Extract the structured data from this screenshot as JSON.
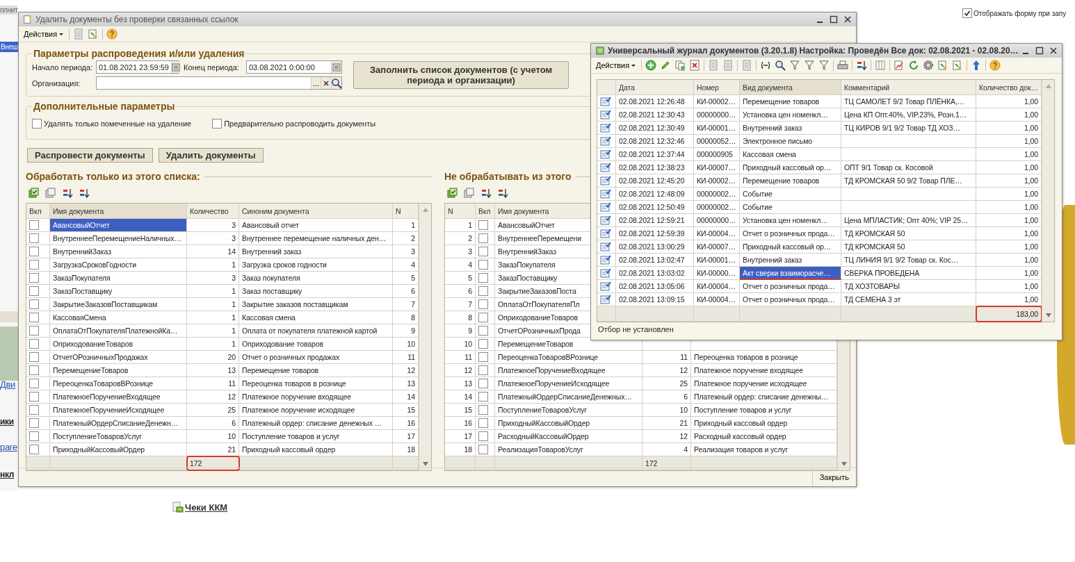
{
  "background": {
    "fragments": [
      {
        "text": "плнит",
        "kind": "title"
      },
      {
        "text": "Внеш",
        "kind": "tab"
      },
      {
        "text": "Дви",
        "kind": "link"
      },
      {
        "text": "ики",
        "kind": "bold"
      },
      {
        "text": "раге",
        "kind": "link"
      },
      {
        "text": "нкл",
        "kind": "bold"
      }
    ],
    "show_form_option": {
      "label": "Отображать форму при запу",
      "checked": true
    },
    "receipts_link": "Чеки ККМ"
  },
  "main_window": {
    "title": "Удалить документы без проверки связанных ссылок",
    "actions_menu": "Действия",
    "params_group": {
      "title": "Параметры распроведения и/или удаления",
      "start_label": "Начало периода:",
      "start_value": "01.08.2021 23:59:59",
      "end_label": "Конец периода:",
      "end_value": "03.08.2021  0:00:00",
      "org_label": "Организация:",
      "org_select_button": "...",
      "fill_button": "Заполнить список документов (с учетом периода и организации)"
    },
    "extra_group": {
      "title": "Дополнительные параметры",
      "options": [
        {
          "label": "Удалять только помеченные на удаление",
          "checked": false
        },
        {
          "label": "Предварительно распроводить документы",
          "checked": false
        }
      ]
    },
    "buttons": [
      "Распровести документы",
      "Удалить документы"
    ],
    "process_list": {
      "title": "Обработать только из этого списка:",
      "columns": [
        "Вкл",
        "Имя документа",
        "Количество",
        "Синоним документа",
        "N"
      ],
      "rows": [
        {
          "checked": false,
          "name": "АвансовыйОтчет",
          "qty": "3",
          "synonym": "Авансовый отчет",
          "n": "1",
          "selected": true
        },
        {
          "checked": false,
          "name": "ВнутреннееПеремещениеНаличных…",
          "qty": "3",
          "synonym": "Внутреннее перемещение наличных ден…",
          "n": "2",
          "selected": false
        },
        {
          "checked": false,
          "name": "ВнутреннийЗаказ",
          "qty": "14",
          "synonym": "Внутренний заказ",
          "n": "3",
          "selected": false
        },
        {
          "checked": false,
          "name": "ЗагрузкаСроковГодности",
          "qty": "1",
          "synonym": "Загрузка сроков годности",
          "n": "4",
          "selected": false
        },
        {
          "checked": false,
          "name": "ЗаказПокупателя",
          "qty": "3",
          "synonym": "Заказ покупателя",
          "n": "5",
          "selected": false
        },
        {
          "checked": false,
          "name": "ЗаказПоставщику",
          "qty": "1",
          "synonym": "Заказ поставщику",
          "n": "6",
          "selected": false
        },
        {
          "checked": false,
          "name": "ЗакрытиеЗаказовПоставщикам",
          "qty": "1",
          "synonym": "Закрытие заказов поставщикам",
          "n": "7",
          "selected": false
        },
        {
          "checked": false,
          "name": "КассоваяСмена",
          "qty": "1",
          "synonym": "Кассовая смена",
          "n": "8",
          "selected": false
        },
        {
          "checked": false,
          "name": "ОплатаОтПокупателяПлатежнойКа…",
          "qty": "1",
          "synonym": "Оплата от покупателя платежной картой",
          "n": "9",
          "selected": false
        },
        {
          "checked": false,
          "name": "ОприходованиеТоваров",
          "qty": "1",
          "synonym": "Оприходование товаров",
          "n": "10",
          "selected": false
        },
        {
          "checked": false,
          "name": "ОтчетОРозничныхПродажах",
          "qty": "20",
          "synonym": "Отчет о розничных продажах",
          "n": "11",
          "selected": false
        },
        {
          "checked": false,
          "name": "ПеремещениеТоваров",
          "qty": "13",
          "synonym": "Перемещение товаров",
          "n": "12",
          "selected": false
        },
        {
          "checked": false,
          "name": "ПереоценкаТоваровВРознице",
          "qty": "11",
          "synonym": "Переоценка товаров в рознице",
          "n": "13",
          "selected": false
        },
        {
          "checked": false,
          "name": "ПлатежноеПоручениеВходящее",
          "qty": "12",
          "synonym": "Платежное поручение входящее",
          "n": "14",
          "selected": false
        },
        {
          "checked": false,
          "name": "ПлатежноеПоручениеИсходящее",
          "qty": "25",
          "synonym": "Платежное поручение исходящее",
          "n": "15",
          "selected": false
        },
        {
          "checked": false,
          "name": "ПлатежныйОрдерСписаниеДенежн…",
          "qty": "6",
          "synonym": "Платежный ордер: списание денежных …",
          "n": "16",
          "selected": false
        },
        {
          "checked": false,
          "name": "ПоступлениеТоваровУслуг",
          "qty": "10",
          "synonym": "Поступление товаров и услуг",
          "n": "17",
          "selected": false
        },
        {
          "checked": false,
          "name": "ПриходныйКассовыйОрдер",
          "qty": "21",
          "synonym": "Приходный кассовый ордер",
          "n": "18",
          "selected": false
        }
      ],
      "total": "172",
      "total_highlighted": true
    },
    "skip_list": {
      "title": "Не обрабатывать из этого",
      "columns": [
        "N",
        "Вкл",
        "Имя документа"
      ],
      "rows": [
        {
          "n": "1",
          "checked": false,
          "name": "АвансовыйОтчет"
        },
        {
          "n": "2",
          "checked": false,
          "name": "ВнутреннееПеремещени"
        },
        {
          "n": "3",
          "checked": false,
          "name": "ВнутреннийЗаказ"
        },
        {
          "n": "4",
          "checked": false,
          "name": "ЗаказПокупателя"
        },
        {
          "n": "5",
          "checked": false,
          "name": "ЗаказПоставщику"
        },
        {
          "n": "6",
          "checked": false,
          "name": "ЗакрытиеЗаказовПоста"
        },
        {
          "n": "7",
          "checked": false,
          "name": "ОплатаОтПокупателяПл"
        },
        {
          "n": "8",
          "checked": false,
          "name": "ОприходованиеТоваров"
        },
        {
          "n": "9",
          "checked": false,
          "name": "ОтчетОРозничныхПрода"
        },
        {
          "n": "10",
          "checked": false,
          "name": "ПеремещениеТоваров"
        },
        {
          "n": "11",
          "checked": false,
          "name": "ПереоценкаТоваровВРознице",
          "qty": "11",
          "synonym": "Переоценка товаров в рознице"
        },
        {
          "n": "12",
          "checked": false,
          "name": "ПлатежноеПоручениеВходящее",
          "qty": "12",
          "synonym": "Платежное поручение входящее"
        },
        {
          "n": "13",
          "checked": false,
          "name": "ПлатежноеПоручениеИсходящее",
          "qty": "25",
          "synonym": "Платежное поручение исходящее"
        },
        {
          "n": "14",
          "checked": false,
          "name": "ПлатежныйОрдерСписаниеДенежных…",
          "qty": "6",
          "synonym": "Платежный ордер: списание денежны…"
        },
        {
          "n": "15",
          "checked": false,
          "name": "ПоступлениеТоваровУслуг",
          "qty": "10",
          "synonym": "Поступление товаров и услуг"
        },
        {
          "n": "16",
          "checked": false,
          "name": "ПриходныйКассовыйОрдер",
          "qty": "21",
          "synonym": "Приходный кассовый ордер"
        },
        {
          "n": "17",
          "checked": false,
          "name": "РасходныйКассовыйОрдер",
          "qty": "12",
          "synonym": "Расходный кассовый ордер"
        },
        {
          "n": "18",
          "checked": false,
          "name": "РеализацияТоваровУслуг",
          "qty": "4",
          "synonym": "Реализация товаров и услуг"
        }
      ],
      "total": "172"
    },
    "close_button": "Закрыть"
  },
  "journal_window": {
    "title": "Универсальный журнал документов (3.20.1.8) Настройка: Проведён Все док: 02.08.2021 - 02.08.20…",
    "actions_menu": "Действия",
    "columns": [
      "Дата",
      "Номер",
      "Вид документа",
      "Комментарий",
      "Количество док…"
    ],
    "rows": [
      {
        "date": "02.08.2021 12:26:48",
        "number": "КИ-00002…",
        "kind": "Перемещение товаров",
        "comment": "ТЦ САМОЛЕТ 9/2 Товар ПЛЁНКА,…",
        "qty": "1,00",
        "selected": false,
        "underlined": false
      },
      {
        "date": "02.08.2021 12:30:43",
        "number": "00000000…",
        "kind": "Установка цен номенкл…",
        "comment": "Цена КП Опт.40%, VIP.23%, Розн.1…",
        "qty": "1,00",
        "selected": false,
        "underlined": false
      },
      {
        "date": "02.08.2021 12:30:49",
        "number": "КИ-00001…",
        "kind": "Внутренний заказ",
        "comment": "ТЦ КИРОВ 9/1 9/2 Товар ТД ХОЗ…",
        "qty": "1,00",
        "selected": false,
        "underlined": false
      },
      {
        "date": "02.08.2021 12:32:46",
        "number": "00000052…",
        "kind": "Электронное письмо",
        "qty": "1,00",
        "selected": false,
        "underlined": false
      },
      {
        "date": "02.08.2021 12:37:44",
        "number": "000000905",
        "kind": "Кассовая смена",
        "qty": "1,00",
        "selected": false,
        "underlined": false
      },
      {
        "date": "02.08.2021 12:38:23",
        "number": "КИ-00007…",
        "kind": "Приходный кассовый ор…",
        "comment": "ОПТ 9/1 Товар ск. Косовой",
        "qty": "1,00",
        "selected": false,
        "underlined": false
      },
      {
        "date": "02.08.2021 12:45:20",
        "number": "КИ-00002…",
        "kind": "Перемещение товаров",
        "comment": "ТД КРОМСКАЯ 50 9/2 Товар ПЛЕ…",
        "qty": "1,00",
        "selected": false,
        "underlined": false
      },
      {
        "date": "02.08.2021 12:48:09",
        "number": "00000002…",
        "kind": "Событие",
        "qty": "1,00",
        "selected": false,
        "underlined": false
      },
      {
        "date": "02.08.2021 12:50:49",
        "number": "00000002…",
        "kind": "Событие",
        "qty": "1,00",
        "selected": false,
        "underlined": false
      },
      {
        "date": "02.08.2021 12:59:21",
        "number": "00000000…",
        "kind": "Установка цен номенкл…",
        "comment": "Цена МПЛАСТИК; Опт 40%; VIP 25…",
        "qty": "1,00",
        "selected": false,
        "underlined": false
      },
      {
        "date": "02.08.2021 12:59:39",
        "number": "КИ-00004…",
        "kind": "Отчет о розничных прода…",
        "comment": "ТД КРОМСКАЯ 50",
        "qty": "1,00",
        "selected": false,
        "underlined": false
      },
      {
        "date": "02.08.2021 13:00:29",
        "number": "КИ-00007…",
        "kind": "Приходный кассовый ор…",
        "comment": "ТД КРОМСКАЯ 50",
        "qty": "1,00",
        "selected": false,
        "underlined": false
      },
      {
        "date": "02.08.2021 13:02:47",
        "number": "КИ-00001…",
        "kind": "Внутренний заказ",
        "comment": "ТЦ ЛИНИЯ 9/1 9/2 Товар ск. Кос…",
        "qty": "1,00",
        "selected": false,
        "underlined": false
      },
      {
        "date": "02.08.2021 13:03:02",
        "number": "КИ-00000…",
        "kind": "Акт сверки взаиморасче…",
        "comment": "СВЕРКА ПРОВЕДЕНА",
        "qty": "1,00",
        "selected": true,
        "underlined": true
      },
      {
        "date": "02.08.2021 13:05:06",
        "number": "КИ-00004…",
        "kind": "Отчет о розничных прода…",
        "comment": "ТД ХОЗТОВАРЫ",
        "qty": "1,00",
        "selected": false,
        "underlined": false
      },
      {
        "date": "02.08.2021 13:09:15",
        "number": "КИ-00004…",
        "kind": "Отчет о розничных прода…",
        "comment": "ТД СЕМЕНА 3 эт",
        "qty": "1,00",
        "selected": false,
        "underlined": false
      }
    ],
    "total": "183,00",
    "total_highlighted": true,
    "filter_status": "Отбор не установлен"
  }
}
